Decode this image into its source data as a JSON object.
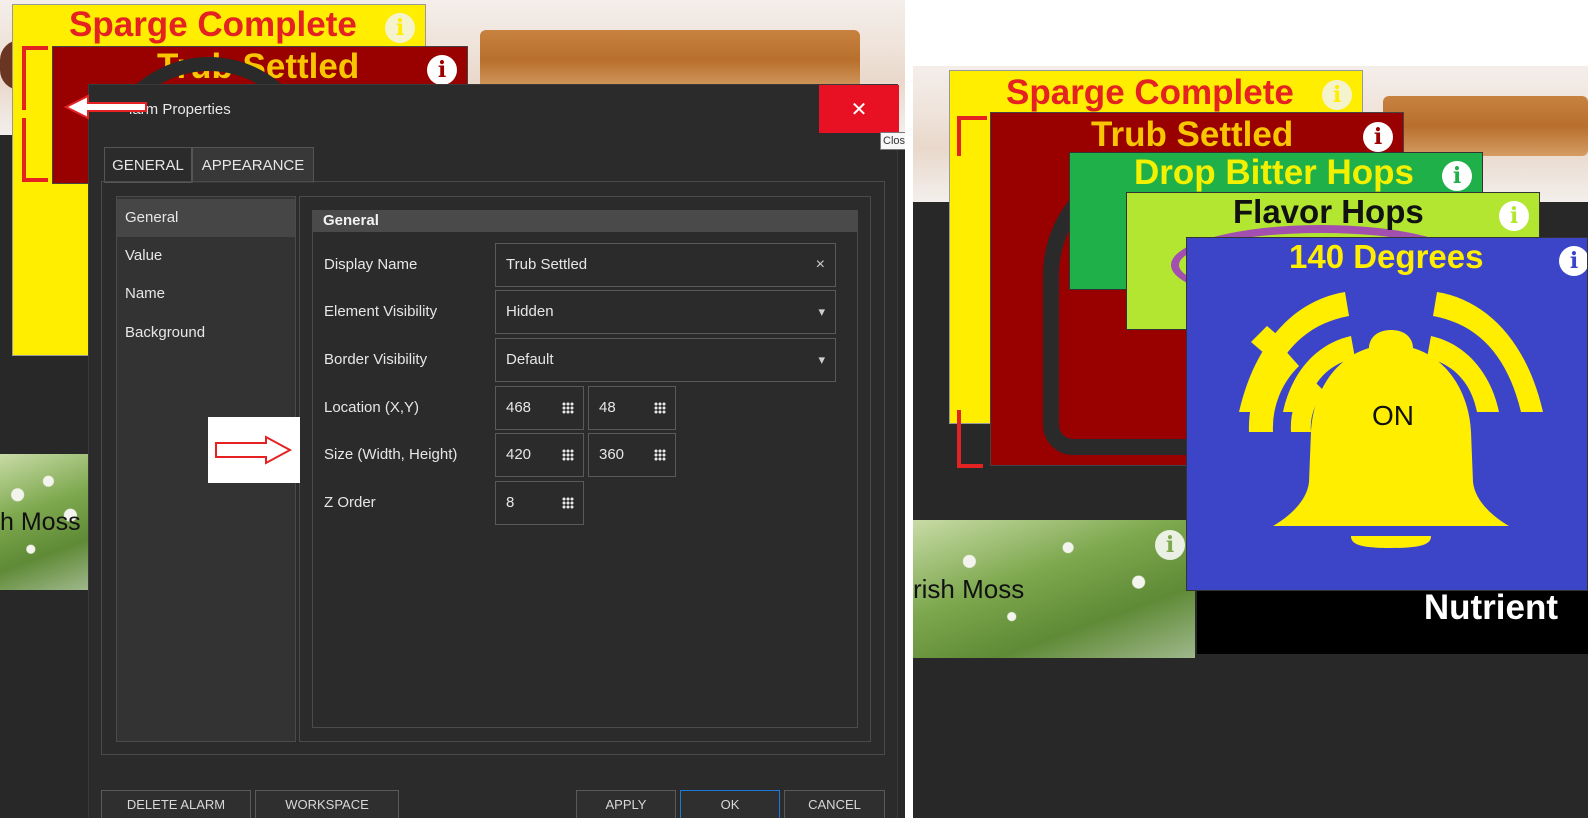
{
  "left": {
    "stickies": {
      "sparge": {
        "title": "Sparge Complete",
        "bg": "#ffee00",
        "text_color": "#e52222"
      },
      "trub": {
        "title": "Trub Settled",
        "bg": "#990000",
        "text_color": "#f7c600"
      },
      "moss": {
        "title": "Irish Moss",
        "visible_text": "h Moss"
      }
    },
    "info_glyph": "i"
  },
  "dialog": {
    "title": "Alarm Properties",
    "visible_title": "larm Properties",
    "close_icon": "close-icon",
    "close_tooltip": "Close",
    "tabs": [
      {
        "label": "GENERAL",
        "active": false
      },
      {
        "label": "APPEARANCE",
        "active": true
      }
    ],
    "nav": [
      {
        "label": "General",
        "selected": true
      },
      {
        "label": "Value",
        "selected": false
      },
      {
        "label": "Name",
        "selected": false
      },
      {
        "label": "Background",
        "selected": false
      }
    ],
    "group_title": "General",
    "fields": {
      "display_name": {
        "label": "Display Name",
        "value": "Trub Settled",
        "clear_glyph": "×"
      },
      "element_visibility": {
        "label": "Element Visibility",
        "value": "Hidden",
        "caret": "▾"
      },
      "border_visibility": {
        "label": "Border Visibility",
        "value": "Default",
        "caret": "▾"
      },
      "location": {
        "label": "Location (X,Y)",
        "x": "468",
        "y": "48"
      },
      "size": {
        "label": "Size (Width, Height)",
        "width": "420",
        "height": "360"
      },
      "z_order": {
        "label": "Z Order",
        "value": "8"
      }
    },
    "buttons": {
      "delete": "DELETE ALARM",
      "workspace": "WORKSPACE",
      "apply": "APPLY",
      "ok": "OK",
      "cancel": "CANCEL"
    }
  },
  "right": {
    "stickies": {
      "sparge": {
        "title": "Sparge Complete",
        "bg": "#ffee00",
        "text_color": "#e52222"
      },
      "trub": {
        "title": "Trub Settled",
        "bg": "#990000",
        "text_color": "#f7c600"
      },
      "bitter": {
        "title": "Drop Bitter Hops",
        "bg": "#1fb04a",
        "text_color": "#f3f000"
      },
      "flavor": {
        "title": "Flavor Hops",
        "bg": "#b2e630",
        "text_color": "#111111"
      },
      "degrees": {
        "title": "140 Degrees",
        "bg": "#3c45c8",
        "text_color": "#ffee00",
        "state": "ON"
      },
      "moss": {
        "title": "Irish Moss",
        "visible_text": "rish Moss"
      },
      "nutrient": {
        "title": "Nutrient"
      }
    },
    "info_glyph": "i"
  },
  "colors": {
    "dark_bg": "#282828",
    "dialog_bg": "#2b2b2b",
    "close_red": "#e81123",
    "accent_blue": "#1e78d7",
    "alarm_yellow": "#ffee00"
  }
}
